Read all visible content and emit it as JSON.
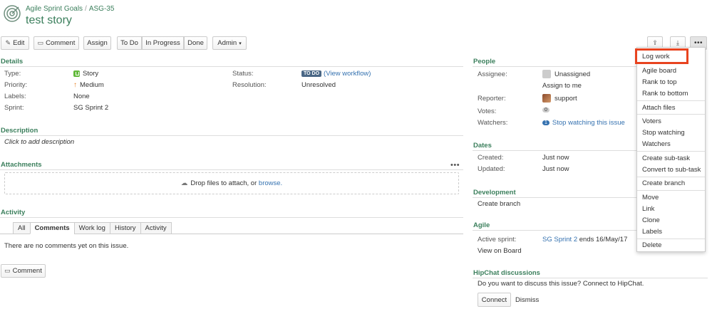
{
  "breadcrumb": {
    "project": "Agile Sprint Goals",
    "separator": "/",
    "issue_key": "ASG-35"
  },
  "issue": {
    "title": "test story"
  },
  "toolbar": {
    "edit": "Edit",
    "comment": "Comment",
    "assign": "Assign",
    "todo": "To Do",
    "in_progress": "In Progress",
    "done": "Done",
    "admin": "Admin"
  },
  "details": {
    "heading": "Details",
    "type_label": "Type:",
    "type_value": "Story",
    "priority_label": "Priority:",
    "priority_value": "Medium",
    "labels_label": "Labels:",
    "labels_value": "None",
    "sprint_label": "Sprint:",
    "sprint_value": "SG Sprint 2",
    "status_label": "Status:",
    "status_lozenge": "TO DO",
    "status_workflow": "(View workflow)",
    "resolution_label": "Resolution:",
    "resolution_value": "Unresolved"
  },
  "description": {
    "heading": "Description",
    "placeholder": "Click to add description"
  },
  "attachments": {
    "heading": "Attachments",
    "drop_text": "Drop files to attach, or",
    "browse": "browse."
  },
  "activity": {
    "heading": "Activity",
    "tabs": [
      "All",
      "Comments",
      "Work log",
      "History",
      "Activity"
    ],
    "empty": "There are no comments yet on this issue.",
    "comment_button": "Comment"
  },
  "people": {
    "heading": "People",
    "assignee_label": "Assignee:",
    "assignee_value": "Unassigned",
    "assign_to_me": "Assign to me",
    "reporter_label": "Reporter:",
    "reporter_value": "support",
    "votes_label": "Votes:",
    "votes_value": "0",
    "watchers_label": "Watchers:",
    "watchers_count": "1",
    "watchers_action": "Stop watching this issue"
  },
  "dates": {
    "heading": "Dates",
    "created_label": "Created:",
    "created_value": "Just now",
    "updated_label": "Updated:",
    "updated_value": "Just now"
  },
  "development": {
    "heading": "Development",
    "create_branch": "Create branch"
  },
  "agile": {
    "heading": "Agile",
    "active_label": "Active sprint:",
    "sprint_link": "SG Sprint 2",
    "sprint_end": "ends 16/May/17",
    "view_board": "View on Board"
  },
  "hipchat": {
    "heading": "HipChat discussions",
    "prompt": "Do you want to discuss this issue? Connect to HipChat.",
    "connect": "Connect",
    "dismiss": "Dismiss"
  },
  "more_menu": {
    "groups": [
      [
        "Log work",
        "Agile board",
        "Rank to top",
        "Rank to bottom"
      ],
      [
        "Attach files"
      ],
      [
        "Voters",
        "Stop watching",
        "Watchers"
      ],
      [
        "Create sub-task",
        "Convert to sub-task"
      ],
      [
        "Create branch"
      ],
      [
        "Move",
        "Link",
        "Clone",
        "Labels"
      ],
      [
        "Delete"
      ]
    ]
  },
  "colors": {
    "accent_green": "#3b7f5c",
    "link_blue": "#3572b0",
    "highlight_red": "#e8431f",
    "lozenge": "#4a6785"
  }
}
